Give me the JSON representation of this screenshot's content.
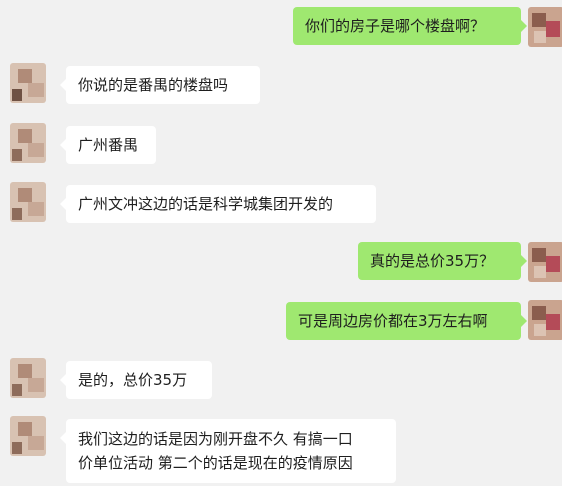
{
  "messages": [
    {
      "id": "m1",
      "side": "out",
      "text": "你们的房子是哪个楼盘啊？"
    },
    {
      "id": "m2",
      "side": "in",
      "text": "你说的是番禺的楼盘吗"
    },
    {
      "id": "m3",
      "side": "in",
      "text": "广州番禺"
    },
    {
      "id": "m4",
      "side": "in",
      "text": "广州文冲这边的话是科学城集团开发的"
    },
    {
      "id": "m5",
      "side": "out",
      "text": "真的是总价35万？"
    },
    {
      "id": "m6",
      "side": "out",
      "text": "可是周边房价都在3万左右啊"
    },
    {
      "id": "m7",
      "side": "in",
      "text": "是的，总价35万"
    },
    {
      "id": "m8",
      "side": "in",
      "lines": [
        "我们这边的话是因为刚开盘不久 有搞一口",
        "价单位活动 第二个的话是现在的疫情原因"
      ]
    }
  ],
  "colors": {
    "background": "#f1f1f1",
    "incoming_bubble": "#ffffff",
    "outgoing_bubble": "#9fe870",
    "text": "#1e1e1e"
  },
  "icons": {
    "avatar": "blurred-avatar-icon"
  }
}
